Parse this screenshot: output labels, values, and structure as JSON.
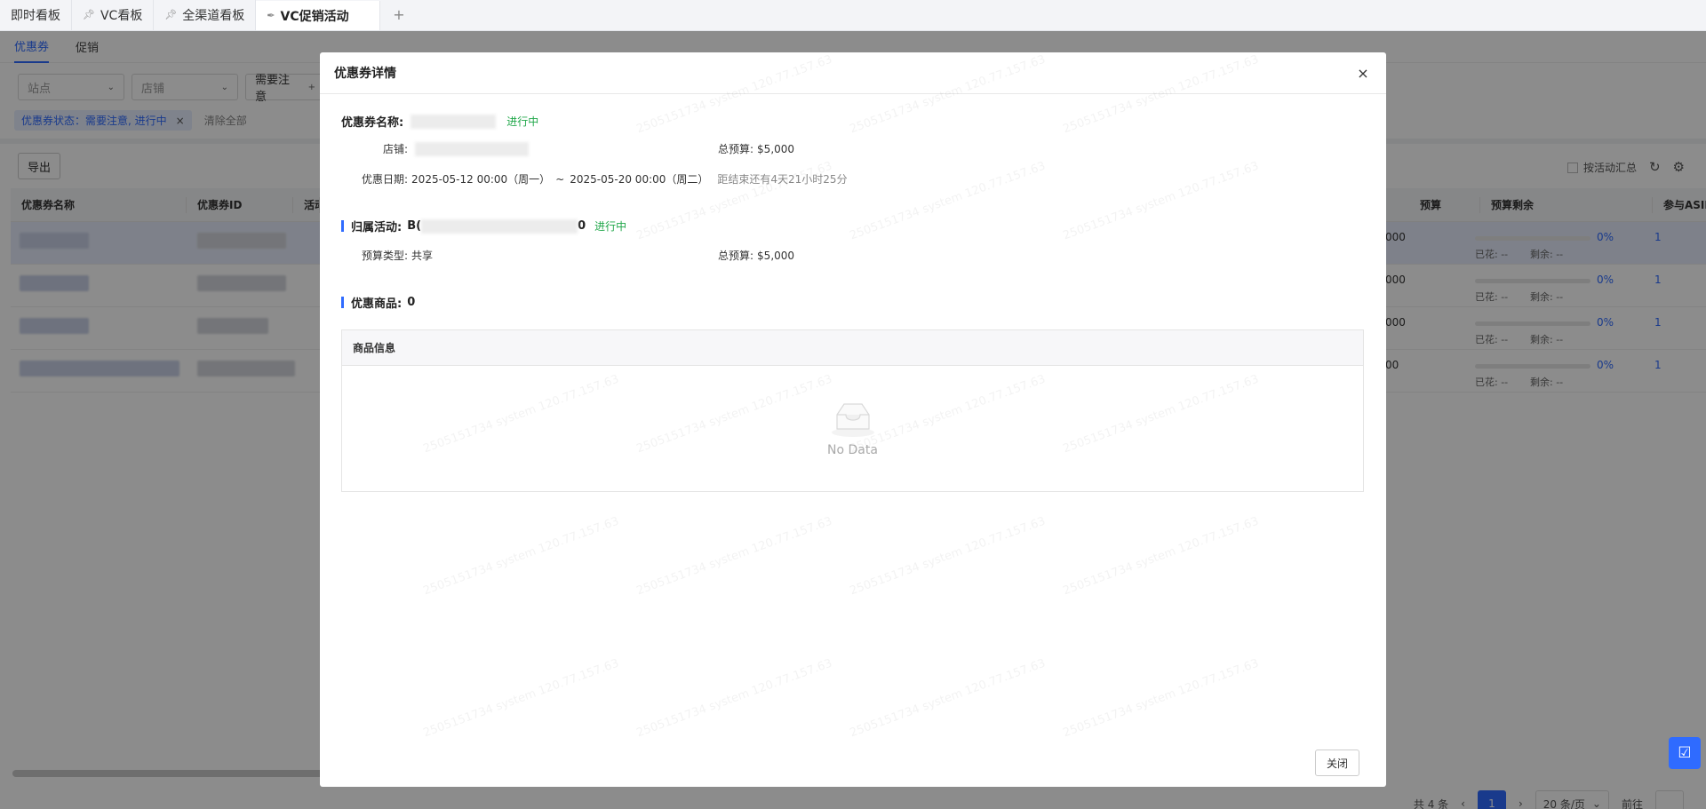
{
  "tabs": [
    {
      "label": "即时看板",
      "pinned": false,
      "active": false
    },
    {
      "label": "VC看板",
      "pinned": true,
      "active": false
    },
    {
      "label": "全渠道看板",
      "pinned": true,
      "active": false
    },
    {
      "label": "VC促销活动",
      "pinned": true,
      "active": true
    }
  ],
  "tab_add": "+",
  "subtabs": [
    {
      "label": "优惠券",
      "active": true
    },
    {
      "label": "促销",
      "active": false
    }
  ],
  "filters": {
    "site": "站点",
    "store": "店铺",
    "attention": "需要注意"
  },
  "chip": {
    "label": "优惠券状态：需要注意, 进行中",
    "close": "×"
  },
  "clear_all": "清除全部",
  "export": "导出",
  "group_by_activity": "按活动汇总",
  "table": {
    "headers": [
      "优惠券名称",
      "优惠券ID",
      "活动",
      "预算",
      "预算剩余",
      "参与ASIN"
    ],
    "rows": [
      {
        "budget": "000",
        "pct": "0%",
        "spent": "已花: --",
        "remain": "剩余: --",
        "asin": "1"
      },
      {
        "budget": "000",
        "pct": "0%",
        "spent": "已花: --",
        "remain": "剩余: --",
        "asin": "1"
      },
      {
        "budget": "000",
        "pct": "0%",
        "spent": "已花: --",
        "remain": "剩余: --",
        "asin": "1"
      },
      {
        "budget": "00",
        "pct": "0%",
        "spent": "已花: --",
        "remain": "剩余: --",
        "asin": "1"
      }
    ]
  },
  "pagination": {
    "total": "共 4 条",
    "current": "1",
    "page_size": "20 条/页",
    "goto": "前往"
  },
  "modal": {
    "title": "优惠券详情",
    "close_icon": "×",
    "coupon_name_label": "优惠券名称:",
    "coupon_status": "进行中",
    "store_label": "店铺:",
    "total_budget_label": "总预算:",
    "total_budget_value": "$5,000",
    "date_label": "优惠日期:",
    "date_start": "2025-05-12 00:00（周一）",
    "date_sep": "~",
    "date_end": "2025-05-20 00:00（周二）",
    "date_remaining": "距结束还有4天21小时25分",
    "activity_label": "归属活动:",
    "activity_prefix": "B(",
    "activity_suffix": "0",
    "activity_status": "进行中",
    "budget_type_label": "预算类型:",
    "budget_type_value": "共享",
    "activity_total_budget_label": "总预算:",
    "activity_total_budget_value": "$5,000",
    "products_label": "优惠商品:",
    "products_count": "0",
    "product_table_header": "商品信息",
    "empty_text": "No Data",
    "footer_close": "关闭"
  },
  "watermark": "2505151734 system 120.77.157.63",
  "colors": {
    "accent": "#2f6bff",
    "status_green": "#21a74a"
  }
}
